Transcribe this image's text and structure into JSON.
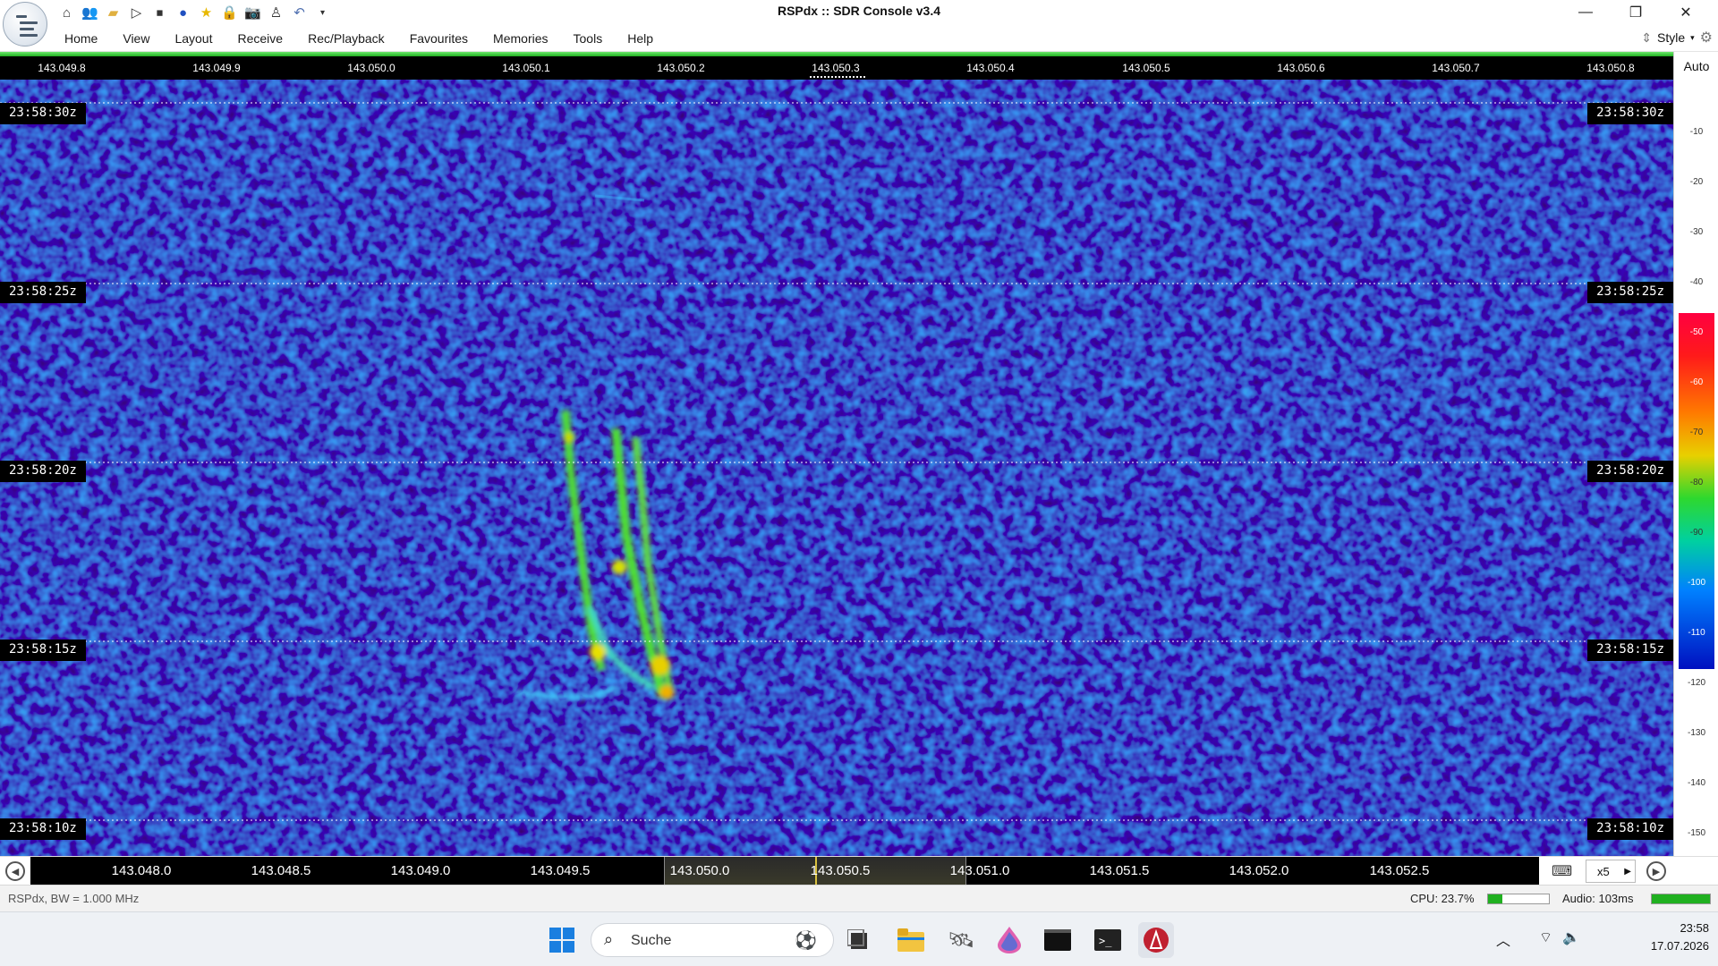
{
  "window": {
    "title": "RSPdx :: SDR Console v3.4",
    "minimize": "—",
    "restore": "❐",
    "close": "✕"
  },
  "quick_access_icons": [
    "home-icon",
    "users-icon",
    "folder-icon",
    "play-icon",
    "stop-icon",
    "record-icon",
    "favourite-star-icon",
    "lock-icon",
    "camera-icon",
    "person-icon",
    "undo-icon",
    "dropdown-icon"
  ],
  "menu": {
    "items": [
      "Home",
      "View",
      "Layout",
      "Receive",
      "Rec/Playback",
      "Favourites",
      "Memories",
      "Tools",
      "Help"
    ],
    "style_label": "Style"
  },
  "top_ruler": [
    "143.049.8",
    "143.049.9",
    "143.050.0",
    "143.050.1",
    "143.050.2",
    "143.050.3",
    "143.050.4",
    "143.050.5",
    "143.050.6",
    "143.050.7",
    "143.050.8"
  ],
  "timestamps": [
    "23:58:30z",
    "23:58:25z",
    "23:58:20z",
    "23:58:15z",
    "23:58:10z"
  ],
  "scale": {
    "mode": "Auto",
    "ticks": [
      "-10",
      "-20",
      "-30",
      "-40",
      "-50",
      "-60",
      "-70",
      "-80",
      "-90",
      "-100",
      "-110",
      "-120",
      "-130",
      "-140",
      "-150"
    ]
  },
  "bottom_ruler": [
    "143.048.0",
    "143.048.5",
    "143.049.0",
    "143.049.5",
    "143.050.0",
    "143.050.5",
    "143.051.0",
    "143.051.5",
    "143.052.0",
    "143.052.5"
  ],
  "zoom": "x5",
  "status": {
    "device": "RSPdx, BW = 1.000 MHz",
    "cpu": "CPU: 23.7%",
    "cpu_fraction": 0.237,
    "audio": "Audio: 103ms",
    "audio_fraction": 1.0
  },
  "taskbar": {
    "search_placeholder": "Suche",
    "time": "23:58",
    "date": "17.07.2026"
  },
  "colors": {
    "accent_green": "#20b020",
    "waterfall_background": "#0a1a8a",
    "signal": "#40e020"
  }
}
